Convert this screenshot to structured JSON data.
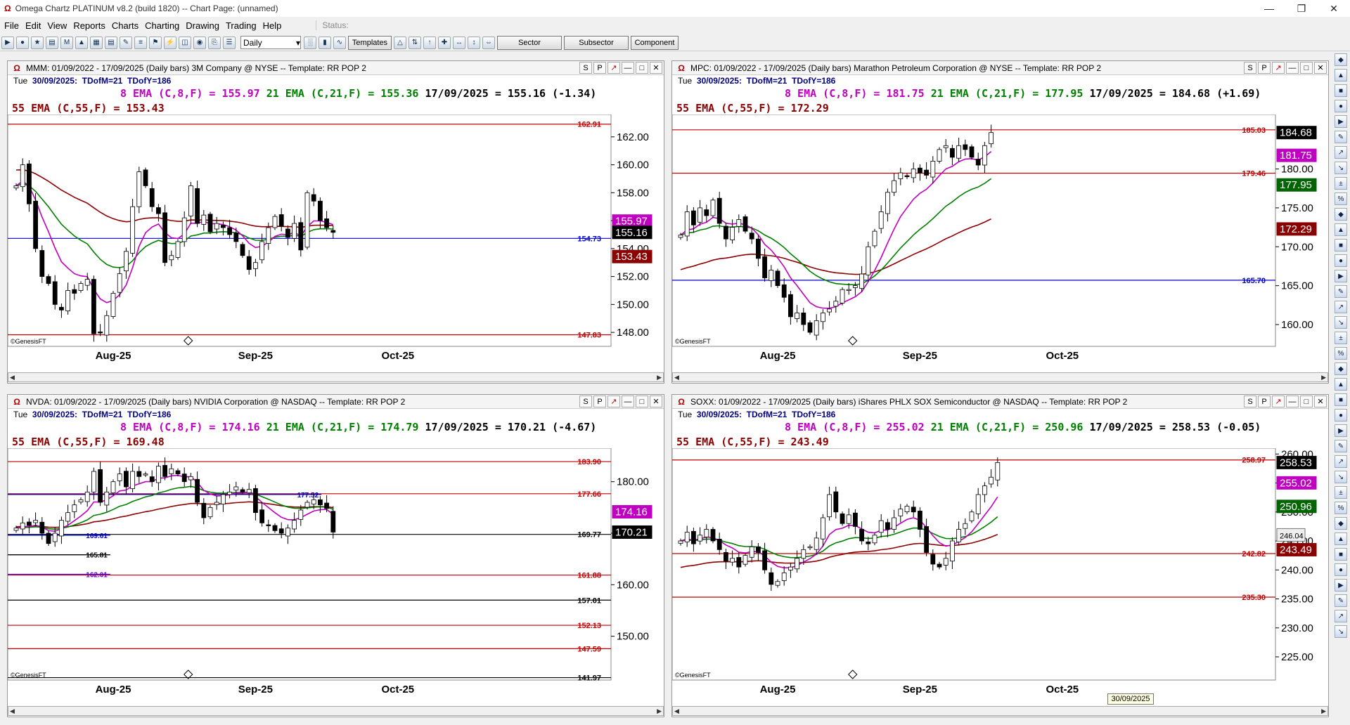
{
  "window": {
    "title": "Omega Chartz PLATINUM v8.2 (build 1820)  --  Chart Page: (unnamed)"
  },
  "menu": [
    "File",
    "Edit",
    "View",
    "Reports",
    "Charts",
    "Charting",
    "Drawing",
    "Trading",
    "Help"
  ],
  "status_label": "Status:",
  "toolbar": {
    "period": "Daily",
    "templates_label": "Templates",
    "sector_label": "Sector",
    "subsector_label": "Subsector",
    "component_label": "Component"
  },
  "right_tools": [
    "select",
    "zoom-in",
    "zoom-out",
    "monitor",
    "line",
    "ray",
    "fib",
    "dollar",
    "horizontal",
    "channel",
    "arrow",
    "text",
    "alert",
    "gann",
    "circle",
    "cycle",
    "range",
    "percent",
    "wave",
    "regression",
    "pitchfork",
    "speed",
    "hline",
    "vline",
    "fan",
    "eraser",
    "magnet",
    "layers",
    "grid",
    "settings",
    "lock",
    "trend",
    "hist",
    "curve",
    "angle",
    "box",
    "tick",
    "marker"
  ],
  "tooltip_date": "30/09/2025",
  "panels": [
    {
      "id": "mmm",
      "header": "MMM:  01/09/2022 - 17/09/2025  (Daily bars)   3M Company @ NYSE  --  Template: RR POP 2",
      "info_day": "Tue",
      "info_date": "30/09/2025:",
      "info_tdm": "TDofM=21",
      "info_tdy": "TDofY=186",
      "ema8": "8 EMA (C,8,F) = 155.97",
      "ema21": "21 EMA (C,21,F) = 155.36",
      "last": "17/09/2025 = 155.16 (-1.34)",
      "ema55": "55 EMA (C,55,F) = 153.43",
      "copyright": "©GenesisFT"
    },
    {
      "id": "mpc",
      "header": "MPC:  01/09/2022 - 17/09/2025  (Daily bars)   Marathon Petroleum Corporation @ NYSE  --  Template: RR POP 2",
      "info_day": "Tue",
      "info_date": "30/09/2025:",
      "info_tdm": "TDofM=21",
      "info_tdy": "TDofY=186",
      "ema8": "8 EMA (C,8,F) = 181.75",
      "ema21": "21 EMA (C,21,F) = 177.95",
      "last": "17/09/2025 = 184.68 (+1.69)",
      "ema55": "55 EMA (C,55,F) = 172.29",
      "copyright": "©GenesisFT"
    },
    {
      "id": "nvda",
      "header": "NVDA:  01/09/2022 - 17/09/2025  (Daily bars)   NVIDIA Corporation @ NASDAQ  --  Template: RR POP 2",
      "info_day": "Tue",
      "info_date": "30/09/2025:",
      "info_tdm": "TDofM=21",
      "info_tdy": "TDofY=186",
      "ema8": "8 EMA (C,8,F) = 174.16",
      "ema21": "21 EMA (C,21,F) = 174.79",
      "last": "17/09/2025 = 170.21 (-4.67)",
      "ema55": "55 EMA (C,55,F) = 169.48",
      "copyright": "©GenesisFT"
    },
    {
      "id": "soxx",
      "header": "SOXX:  01/09/2022 - 17/09/2025  (Daily bars)   iShares PHLX SOX Semiconductor @ NASDAQ  --  Template: RR POP 2",
      "info_day": "Tue",
      "info_date": "30/09/2025:",
      "info_tdm": "TDofM=21",
      "info_tdy": "TDofY=186",
      "ema8": "8 EMA (C,8,F) = 255.02",
      "ema21": "21 EMA (C,21,F) = 250.96",
      "last": "17/09/2025 = 258.53 (-0.05)",
      "ema55": "55 EMA (C,55,F) = 243.49",
      "copyright": "©GenesisFT"
    }
  ],
  "chart_data": [
    {
      "id": "mmm",
      "type": "candlestick",
      "ylim": [
        147,
        163.6
      ],
      "y_ticks": [
        148,
        150,
        152,
        154,
        156,
        158,
        160,
        162
      ],
      "x_labels": [
        {
          "label": "Aug-25",
          "i": 15
        },
        {
          "label": "Sep-25",
          "i": 37
        },
        {
          "label": "Oct-25",
          "i": 59
        }
      ],
      "levels": [
        {
          "value": 162.91,
          "label": "162.91",
          "color": "#c00000"
        },
        {
          "value": 154.73,
          "label": "154.73",
          "color": "#0000cc"
        },
        {
          "value": 147.83,
          "label": "147.83",
          "color": "#c00000"
        }
      ],
      "tags": [
        {
          "value": 155.97,
          "text": "155.97",
          "bg": "#c000c0"
        },
        {
          "value": 155.16,
          "text": "155.16",
          "bg": "#000000"
        },
        {
          "value": 153.43,
          "text": "153.43",
          "bg": "#8b0000"
        }
      ],
      "closes": [
        158.5,
        160.0,
        157.2,
        154.0,
        152.0,
        151.5,
        150.0,
        149.6,
        151.0,
        150.8,
        151.5,
        151.8,
        147.9,
        148.0,
        149.2,
        150.8,
        152.2,
        153.8,
        157.0,
        159.5,
        158.5,
        157.0,
        156.5,
        153.0,
        153.5,
        154.5,
        156.2,
        158.5,
        155.8,
        156.4,
        155.2,
        155.8,
        155.5,
        155.0,
        154.5,
        153.5,
        152.5,
        153.0,
        154.5,
        155.5,
        156.3,
        155.6,
        154.8,
        155.8,
        153.9,
        158.0,
        157.4,
        156.0,
        155.5,
        155.16
      ]
    },
    {
      "id": "mpc",
      "type": "candlestick",
      "ylim": [
        157.2,
        187.0
      ],
      "y_ticks": [
        160,
        165,
        170,
        175,
        180
      ],
      "x_labels": [
        {
          "label": "Aug-25",
          "i": 15
        },
        {
          "label": "Sep-25",
          "i": 37
        },
        {
          "label": "Oct-25",
          "i": 59
        }
      ],
      "levels": [
        {
          "value": 185.03,
          "label": "185.03",
          "color": "#c00000"
        },
        {
          "value": 179.46,
          "label": "179.46",
          "color": "#c00000"
        },
        {
          "value": 165.7,
          "label": "165.70",
          "color": "#0000cc"
        }
      ],
      "tags": [
        {
          "value": 184.68,
          "text": "184.68",
          "bg": "#000000"
        },
        {
          "value": 181.75,
          "text": "181.75",
          "bg": "#c000c0"
        },
        {
          "value": 177.95,
          "text": "177.95",
          "bg": "#006400"
        },
        {
          "value": 172.29,
          "text": "172.29",
          "bg": "#8b0000"
        }
      ],
      "closes": [
        171.5,
        174.5,
        172.8,
        175.0,
        174.0,
        176.0,
        173.0,
        171.0,
        172.5,
        173.5,
        172.0,
        171.0,
        168.5,
        166.0,
        167.0,
        165.0,
        163.5,
        161.0,
        161.5,
        160.0,
        159.0,
        160.5,
        161.5,
        162.0,
        163.0,
        164.5,
        164.5,
        165.0,
        166.5,
        170.0,
        172.0,
        174.5,
        177.0,
        178.5,
        179.5,
        179.0,
        180.0,
        179.5,
        179.2,
        181.0,
        182.5,
        183.0,
        181.5,
        183.0,
        182.5,
        181.5,
        180.5,
        183.0,
        184.68
      ]
    },
    {
      "id": "nvda",
      "type": "candlestick",
      "ylim": [
        141.5,
        186.5
      ],
      "y_ticks": [
        150,
        160,
        170,
        180
      ],
      "x_labels": [
        {
          "label": "Aug-25",
          "i": 15
        },
        {
          "label": "Sep-25",
          "i": 37
        },
        {
          "label": "Oct-25",
          "i": 59
        }
      ],
      "levels": [
        {
          "value": 183.9,
          "label": "183.90",
          "color": "#c00000"
        },
        {
          "value": 177.66,
          "label": "177.66",
          "color": "#c00000"
        },
        {
          "value": 169.77,
          "label": "169.77",
          "color": "#000000"
        },
        {
          "value": 161.88,
          "label": "161.88",
          "color": "#c00000"
        },
        {
          "value": 157.01,
          "label": "157.01",
          "color": "#000000"
        },
        {
          "value": 152.13,
          "label": "152.13",
          "color": "#c00000"
        },
        {
          "value": 147.59,
          "label": "147.59",
          "color": "#c00000"
        },
        {
          "value": 141.97,
          "label": "141.97",
          "color": "#000000"
        }
      ],
      "short_levels": [
        {
          "value": 177.52,
          "label": "177.52",
          "color": "#0000cc",
          "from": 0,
          "to": 0.52
        },
        {
          "value": 169.61,
          "label": "169.61",
          "color": "#0000cc",
          "from": 0,
          "to": 0.17
        },
        {
          "value": 165.81,
          "label": "165.81",
          "color": "#000000",
          "from": 0,
          "to": 0.17
        },
        {
          "value": 162.01,
          "label": "162.01",
          "color": "#6600cc",
          "from": 0,
          "to": 0.17
        }
      ],
      "tags": [
        {
          "value": 174.16,
          "text": "174.16",
          "bg": "#c000c0"
        },
        {
          "value": 170.21,
          "text": "170.21",
          "bg": "#000000"
        }
      ],
      "closes": [
        171.0,
        172.0,
        171.5,
        172.5,
        170.0,
        168.0,
        170.0,
        172.5,
        174.0,
        175.5,
        176.5,
        178.0,
        182.0,
        176.0,
        178.0,
        180.0,
        181.5,
        179.0,
        182.0,
        181.0,
        181.5,
        180.0,
        183.0,
        181.0,
        182.5,
        181.5,
        180.0,
        181.0,
        176.0,
        173.0,
        175.0,
        176.0,
        177.5,
        178.0,
        179.0,
        178.0,
        178.5,
        174.0,
        172.0,
        171.5,
        170.5,
        170.0,
        171.0,
        172.5,
        174.5,
        176.0,
        176.5,
        175.5,
        174.8,
        170.21
      ]
    },
    {
      "id": "soxx",
      "type": "candlestick",
      "ylim": [
        221.0,
        261.0
      ],
      "y_ticks": [
        225,
        230,
        235,
        240,
        245,
        250,
        255,
        260
      ],
      "x_labels": [
        {
          "label": "Aug-25",
          "i": 15
        },
        {
          "label": "Sep-25",
          "i": 37
        },
        {
          "label": "Oct-25",
          "i": 59
        }
      ],
      "levels": [
        {
          "value": 258.97,
          "label": "258.97",
          "color": "#c00000"
        },
        {
          "value": 242.82,
          "label": "242.82",
          "color": "#c00000"
        },
        {
          "value": 235.3,
          "label": "235.30",
          "color": "#c00000"
        }
      ],
      "tags": [
        {
          "value": 258.53,
          "text": "258.53",
          "bg": "#000000"
        },
        {
          "value": 255.02,
          "text": "255.02",
          "bg": "#c000c0"
        },
        {
          "value": 250.96,
          "text": "250.96",
          "bg": "#006400"
        },
        {
          "value": 243.49,
          "text": "243.49",
          "bg": "#8b0000"
        },
        {
          "value": 246.04,
          "text": "246.04",
          "bg": "#eeeeee"
        }
      ],
      "closes": [
        245.0,
        246.5,
        244.5,
        246.0,
        247.0,
        245.0,
        243.5,
        241.5,
        242.0,
        240.5,
        242.5,
        244.0,
        243.0,
        240.0,
        237.5,
        238.0,
        239.5,
        240.5,
        242.0,
        243.5,
        244.0,
        245.5,
        249.0,
        253.0,
        250.0,
        248.0,
        249.5,
        247.5,
        245.0,
        244.5,
        246.0,
        248.5,
        247.0,
        249.0,
        250.5,
        251.0,
        250.0,
        247.0,
        243.0,
        241.0,
        240.5,
        242.0,
        245.0,
        247.0,
        248.0,
        250.0,
        253.0,
        254.5,
        256.0,
        258.53
      ]
    }
  ]
}
